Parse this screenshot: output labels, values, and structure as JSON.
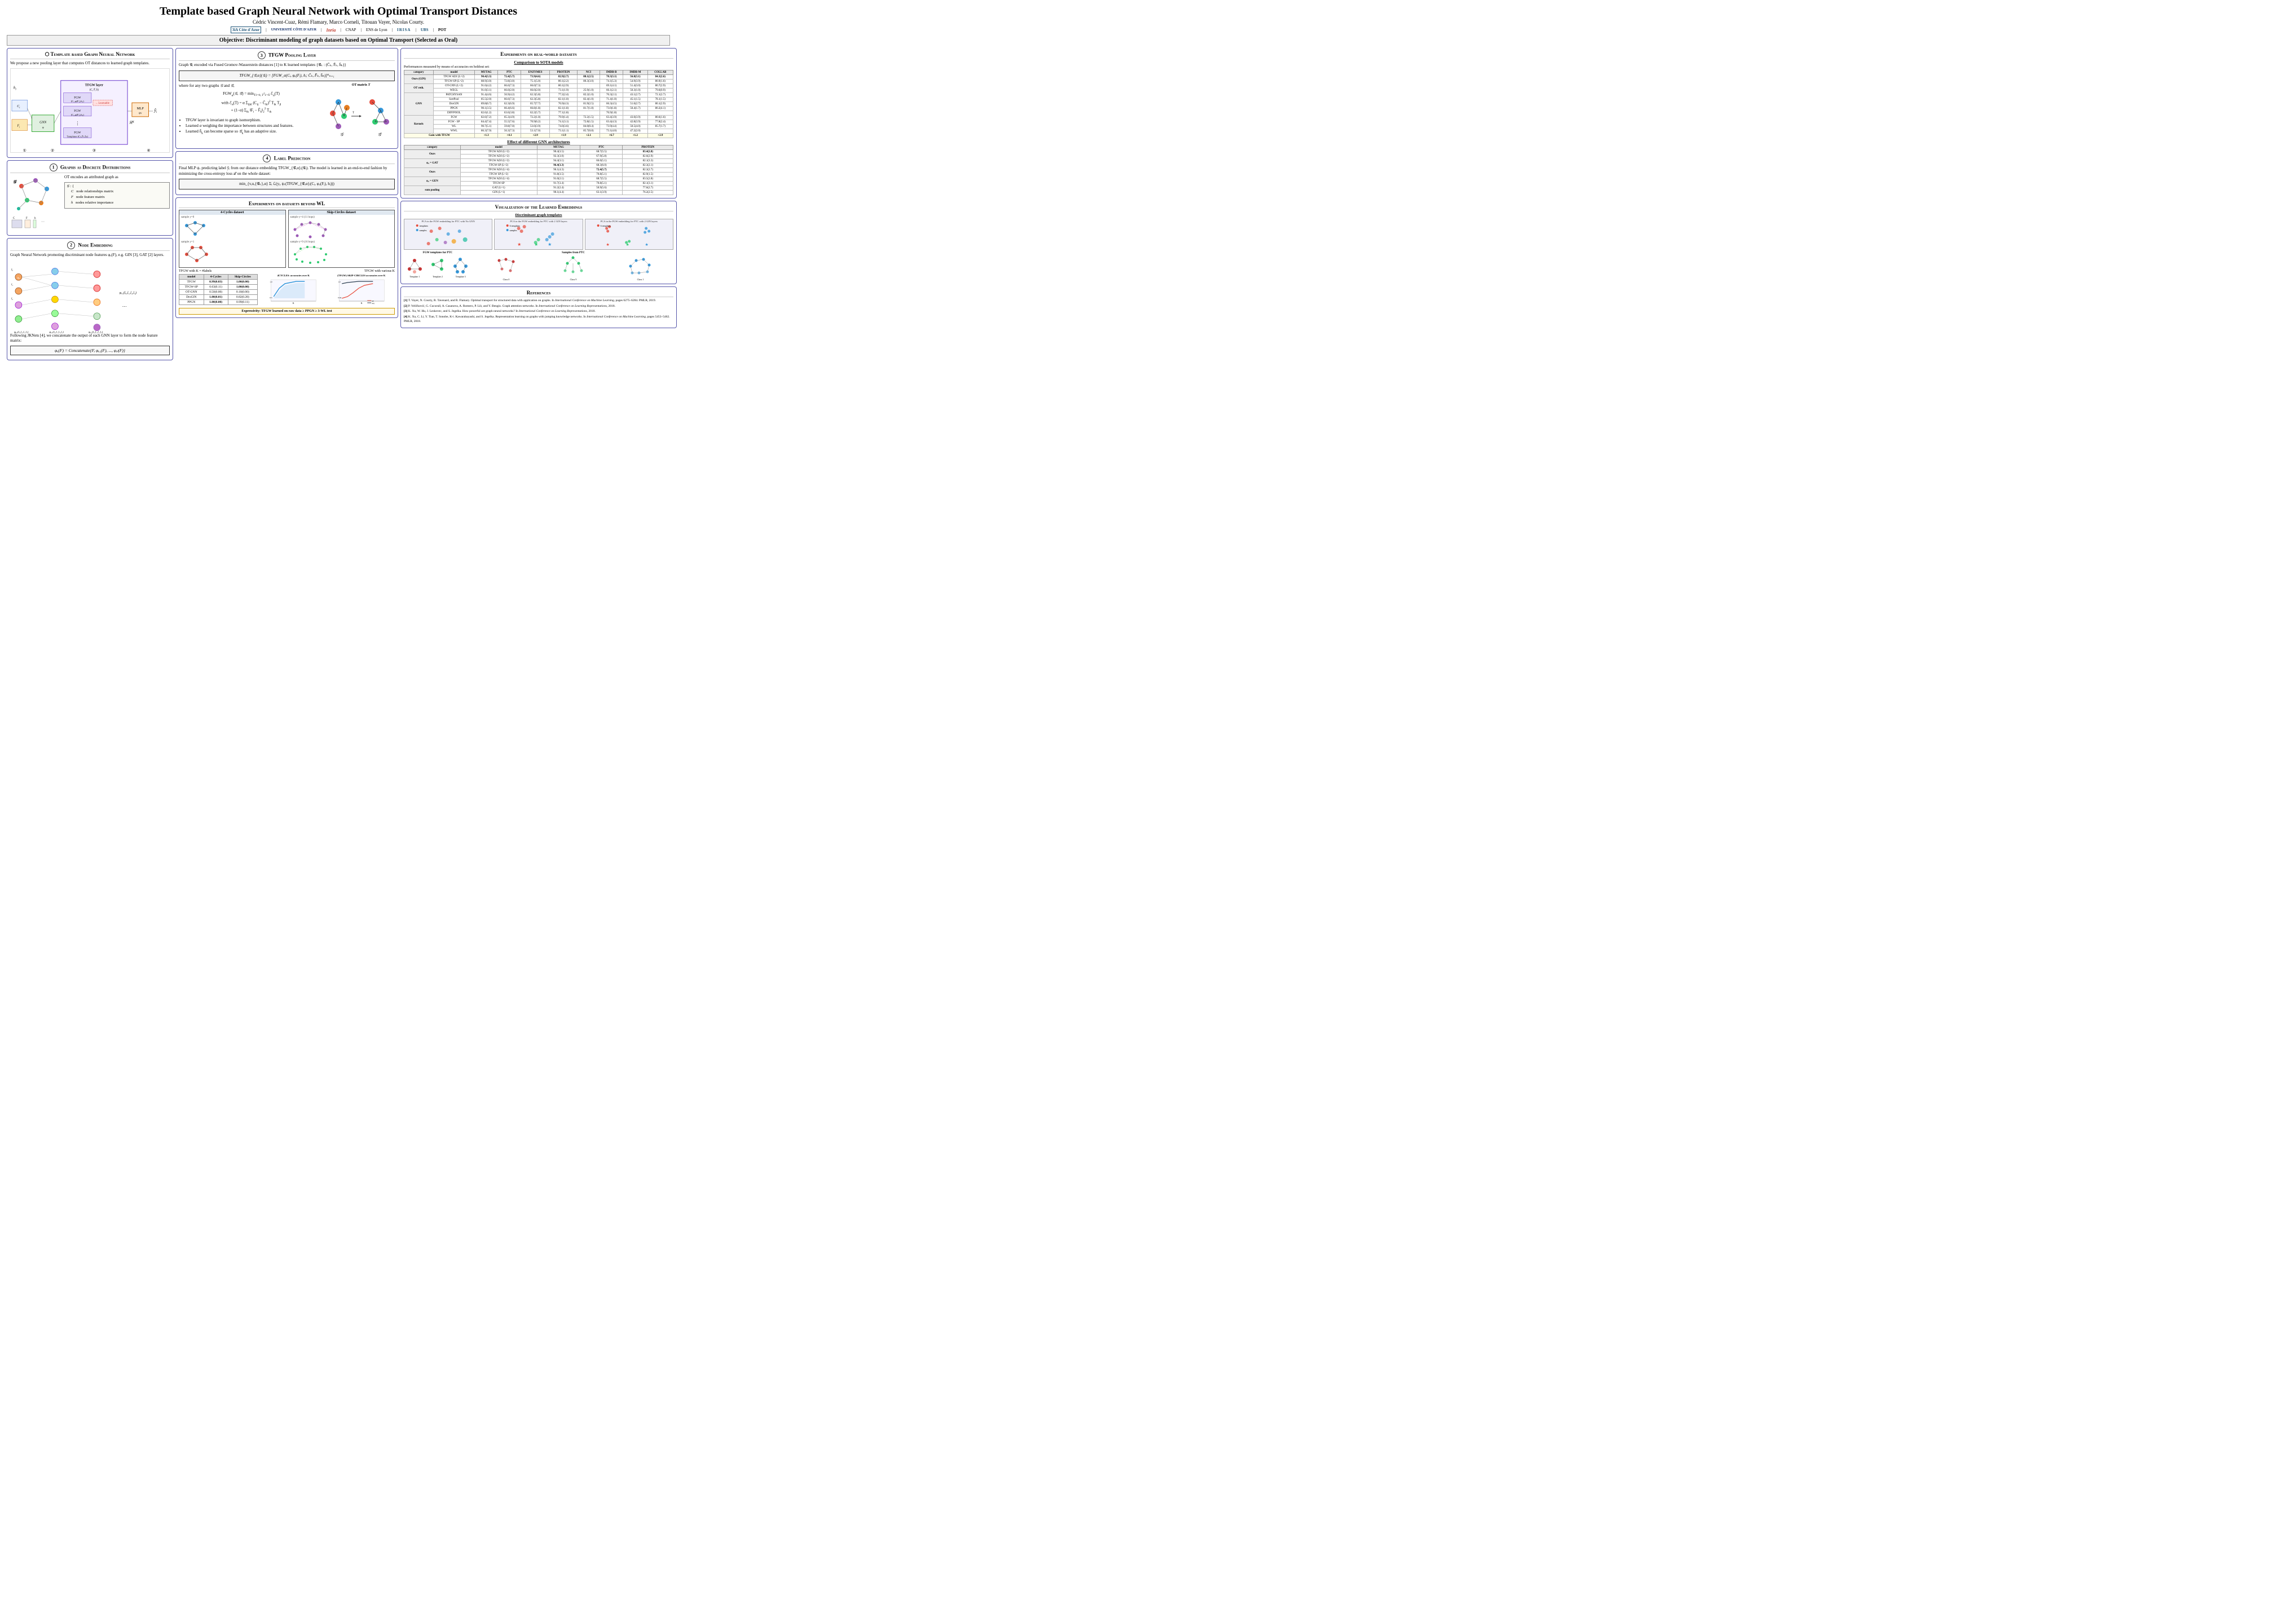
{
  "header": {
    "title": "Template based Graph Neural Network with Optimal Transport Distances",
    "authors": "Cédric Vincent-Cuaz,  Rémi Flamary,  Marco Corneli,  Titouan Vayer,  Nicolas Courty.",
    "objective": "Objective: Discriminant modeling of graph datasets based on Optimal Transport (Selected as Oral)"
  },
  "affiliations": [
    {
      "name": "3IA Côte d'Azur",
      "abbr": "3iA"
    },
    {
      "name": "Université Côte d'Azur",
      "abbr": "UCA"
    },
    {
      "name": "Inria",
      "abbr": "Inria"
    },
    {
      "name": "CNAP",
      "abbr": "CNAP"
    },
    {
      "name": "ENS de Lyon",
      "abbr": "ENS"
    },
    {
      "name": "LAIF IRISA",
      "abbr": "IRISA"
    },
    {
      "name": "UBS",
      "abbr": "UBS"
    },
    {
      "name": "POT",
      "abbr": "POT"
    }
  ],
  "boxes": {
    "template_gnn": {
      "title": "Template based Graph Neural Network",
      "num": "",
      "text": "We propose a new pooling layer that computes OT distances to learned graph templates."
    },
    "tfgw_pooling": {
      "title": "TFGW Pooling Layer",
      "num": "3",
      "intro": "Graph 𝒢ᵢ encoded via Fused Gromov-Wasserstein distances [1] to K learned templates {𝒢̄ₖ : (C̄ₖ, F̄ₖ, h̄ₖ)}",
      "formula_main": "TFGW_{𝒢̄,α}(𝒢ᵢ) = [FGW_α(Cᵢ, φᵤ(Fᵢ), hᵢ; C̄ₖ, F̄ₖ, h̄ₖ)]ᴷₖ₌₁",
      "formula_fgw": "FGW_α(𝒢, 𝒢̄) = min_{T1=h, Tᵀ1=h̄} ℰ_α(T)",
      "formula_energy1": "ℰ_α(T) = α Σᵢⱼₖₗ (Cᵢⱼ − C̄ₖₗ)² Tᵢₖ Tⱼₗ",
      "formula_energy2": "+ (1−α) Σᵢₖ ‖Fᵢ − F̄ₖ‖₂² Tᵢₖ",
      "bullets": [
        "TFGW layer is invariant to graph isomorphism.",
        "Learned α weighing the importance between structures and features.",
        "Learned h̄ₖ can become sparse so 𝒢̄ₖ has an adaptive size."
      ]
    },
    "graphs_distributions": {
      "title": "Graphs as discrete distributions",
      "num": "1",
      "text": "OT encodes an attributed graph as",
      "formula": "𝒢 : { C  node relationships matrix\n      F  node feature matrix\n      h  nodes relative importance"
    },
    "node_embedding": {
      "title": "Node Embedding",
      "num": "2",
      "text": "Graph Neural Network promoting discriminant node features φᵤ(F), e.g. GIN [3], GAT [2] layers.",
      "formula_concat": "φᵤ(F) = Concatenate{F, φᵤ₁(F), ..., φᵤₗ(F)}"
    },
    "label_prediction": {
      "title": "Label Prediction",
      "num": "4",
      "text": "Final MLP ψᵥ predicting label ȳᵢ from our distance embedding TFGW_{𝒢̄,α}ᵢ(𝒢ᵢ). The model is learned in an end-to-end fashion by minimizing the cross-entropy loss ℒ on the whole dataset:",
      "formula": "min_{v,u,{𝒢̄ₖ},α} Σᵢ ℒ(yᵢ, ψᵥ(TFGW_{𝒢̄,α}ᵢ(Cᵢ, φᵤ(Fᵢ), hᵢ)))"
    },
    "experiments_wl": {
      "title": "Experiments on datasets beyond WL",
      "datasets": [
        "4-Cycles dataset",
        "Skip-Circles dataset"
      ],
      "tfgw_k_labels": "TFGW with K = #labels",
      "tfgw_various_k": "TFGW with various K",
      "table": {
        "headers": [
          "model",
          "4-Cycles",
          "Skip-Circles"
        ],
        "rows": [
          [
            "TFGW",
            "0.99(0.03)",
            "1.00(0.00)"
          ],
          [
            "TFGW-SP",
            "0.63(0.11)",
            "1.00(0.00)"
          ],
          [
            "OT-GNN",
            "0.50(0.00)",
            "0.10(0.00)"
          ],
          [
            "DroGIN",
            "1.00(0.01)",
            "0.82(0.28)"
          ],
          [
            "PPGN",
            "1.00(0.00)",
            "0.99(0.11)"
          ]
        ]
      },
      "expressivity": "Expressivity: TFGW learned on raw data ≥ PPGN ≥ 3-WL test"
    },
    "experiments_real": {
      "title": "Experiments on real-world datasets",
      "subtitle": "Comparison to SOTA models",
      "intro": "Performances measured by means of accuracies on holdout set:",
      "table": {
        "headers": [
          "category",
          "model",
          "MUTAG",
          "PTC",
          "ENZYMES",
          "PROTEIN",
          "NCI",
          "IMDB-B",
          "IMDB-M",
          "COLLAB"
        ],
        "rows": [
          [
            "Ours (GIN)",
            "TFGW ADJ (L=2)",
            "90.4(3.3)",
            "72.4(5.7)",
            "73.9(4.6)",
            "82.9(2.7)",
            "88.1(2.5)",
            "78.3(3.1)",
            "56.8(3.1)",
            "84.3(2.6)"
          ],
          [
            "",
            "TFGW-SP (L=2)",
            "88.9(3.0)",
            "72.8(3.0)",
            "75.1(5.0)",
            "80.1(2.2)",
            "80.3(3.0)",
            "74.1(5.3)",
            "54.9(3.9)",
            "80.9(1.6)"
          ],
          [
            "OT reth.",
            "OT-GNN (L=2)",
            "91.0(4.2)",
            "66.6(7.3)",
            "66.0(7.3)",
            "80.1(2.9)",
            "",
            "69.1(4.1)",
            "51.4(3.0)",
            "80.7(2.9)"
          ],
          [
            "",
            "WEGL",
            "91.0(3.1)",
            "66.0(2.0)",
            "66.0(2.0)",
            "73.1(1.9)",
            "25.9(1.0)",
            "66.1(2.1)",
            "50.3(1.0)",
            "79.6(0.9)"
          ],
          [
            "GNN",
            "PATCHYSAN",
            "91.4(4.6)",
            "56.9(4.2)",
            "62.3(5.8)",
            "77.2(2.4)",
            "82.2(1.0)",
            "76.3(2.1)",
            "43.1(2.7)",
            "72.1(2.7)"
          ],
          [
            "",
            "SortPool",
            "85.5(2.0)",
            "66.6(7.3)",
            "62.3(5.8)",
            "82.1(1.0)",
            "82.4(1.0)",
            "71.4(1.0)",
            "45.1(1.5)",
            "78.1(1.5)"
          ],
          [
            "",
            "DroGIN",
            "89.8(6.7)",
            "62.3(6.9)",
            "65.7(7.7)",
            "76.9(4.3)",
            "81.9(2.5)",
            "66.3(4.5)",
            "51.6(2.7)",
            "80.1(2.9)"
          ],
          [
            "",
            "PPGN",
            "90.1(3.5)",
            "66.4(6.6)",
            "66.8(1.8)",
            "82.1(1.8)",
            "81.7(1.8)",
            "73.0(1.8)",
            "50.4(1.7)",
            "80.2(4.1)"
          ],
          [
            "",
            "DIFFPOOL",
            "82.6(1.2)",
            "63.6(3.8)",
            "62.2(5.7)",
            "77.1(1.8)",
            "",
            "76.9(1.8)",
            "",
            ""
          ],
          [
            "Kernels",
            "FGW",
            "82.6(7.2)",
            "65.3(4.9)",
            "72.2(1.0)",
            "79.9(1.4)",
            "72.2(1.5)",
            "63.4(3.9)",
            "43.0(3.9)",
            "80.6(1.6)"
          ],
          [
            "",
            "FGW - SP",
            "84.4(7.4)",
            "55.5(7.6)",
            "70.9(6.2)",
            "74.1(3.1)",
            "72.8(1.5)",
            "63.4(4.3)",
            "42.8(3.9)",
            "77.8(2.4)"
          ],
          [
            "",
            "WL",
            "90.7(5.1)",
            "59.8(7.0)",
            "53.0(3.9)",
            "74.0(3.6)",
            "84.0(0.4)",
            "73.9(4.4)",
            "50.5(4.0)",
            "85.7(1.7)"
          ],
          [
            "",
            "WWL",
            "86.3(7.9)",
            "56.3(7.3)",
            "53.1(7.0)",
            "73.1(1.1)",
            "85.7(0.8)",
            "73.1(4.0)",
            "47.2(2.0)",
            ""
          ],
          [
            "Gain with TFGW",
            "",
            "+1.3",
            "+4.1",
            "+2.9",
            "+1.9",
            "+2.1",
            "+6.7",
            "+1.2",
            "+2.9"
          ]
        ]
      },
      "subtitle2": "Effect of different GNN architectures",
      "table2": {
        "headers": [
          "category",
          "model",
          "MUTAG",
          "PTC",
          "PROTEIN"
        ],
        "rows": [
          [
            "Ours",
            "TFGW ADJ (L=2)",
            "90.4(3.5)",
            "68.7(5.5)",
            "83.4(2.8)"
          ],
          [
            "",
            "TFGW ADJ (L=2)",
            "92.3(3.0)",
            "67.9(5.8)",
            "82.6(2.9)"
          ],
          [
            "φᵤ = GAT",
            "TFGW ADJ (L=2)",
            "94.4(3.1)",
            "66.0(5.1)",
            "82.1(3.3)"
          ],
          [
            "",
            "TFGW-SP (L=2)",
            "96.4(3.3)",
            "68.3(6.0)",
            "82.3(2.1)"
          ],
          [
            "Ours",
            "TFGW ADJ (L=4)",
            "96.1(4.3)",
            "72.4(5.7)",
            "82.3(2.7)"
          ],
          [
            "",
            "TFGW SP (L=2)",
            "91.8(3.5)",
            "70.8(5.1)",
            "82.9(1.5)"
          ],
          [
            "φᵤ = GEN",
            "TFGW ADJ (L=4)",
            "91.0(2.1)",
            "68.7(5.5)",
            "83.5(2.8)"
          ],
          [
            "",
            "TFGW-SP",
            "91.7(3.4)",
            "70.8(5.1)",
            "82.1(3.1)"
          ],
          [
            "sum pooling",
            "GAT (L=1)",
            "91.2(2.4)",
            "50.9(5.6)",
            "77.6(2.7)"
          ],
          [
            "",
            "GIN (L=1)",
            "90.1(4.4)",
            "63.1(3.9)",
            "76.2(2.5)"
          ]
        ]
      }
    },
    "visualization": {
      "title": "Visualization of the learned embeddings",
      "subtitle": "Discriminant graph templates",
      "pca_plots": [
        "PCA in the FGW embedding for PTC with No GNN",
        "PCA in the FGW embedding for PTC with 2 GIN layers",
        "PCA in the FGW embedding for PTC with 2 GIN layers"
      ]
    },
    "references": {
      "title": "References",
      "items": [
        "[1] T. Vayer, N. Courty, R. Tavenard, and R. Flamary. Optimal transport for structured data with application on graphs. In International Conference on Machine Learning, pages 6275–6284. PMLR, 2019.",
        "[2] P. Veličković, G. Cucurull, A. Casanova, A. Romero, P. Liò, and Y. Bengio. Graph attention networks. In International Conference on Learning Representations, 2018.",
        "[3] K. Xu, W. Hu, J. Leskovec, and S. Jegelka. How powerful are graph neural networks? In International Conference on Learning Representations, 2018.",
        "[4] K. Xu, C. Li, Y. Tian, T. Sonobe, K-i. Kawarabayashi, and S. Jegelka. Representation learning on graphs with jumping knowledge networks. In International Conference on Machine Learning, pages 5453–5462. PMLR, 2018."
      ]
    }
  }
}
